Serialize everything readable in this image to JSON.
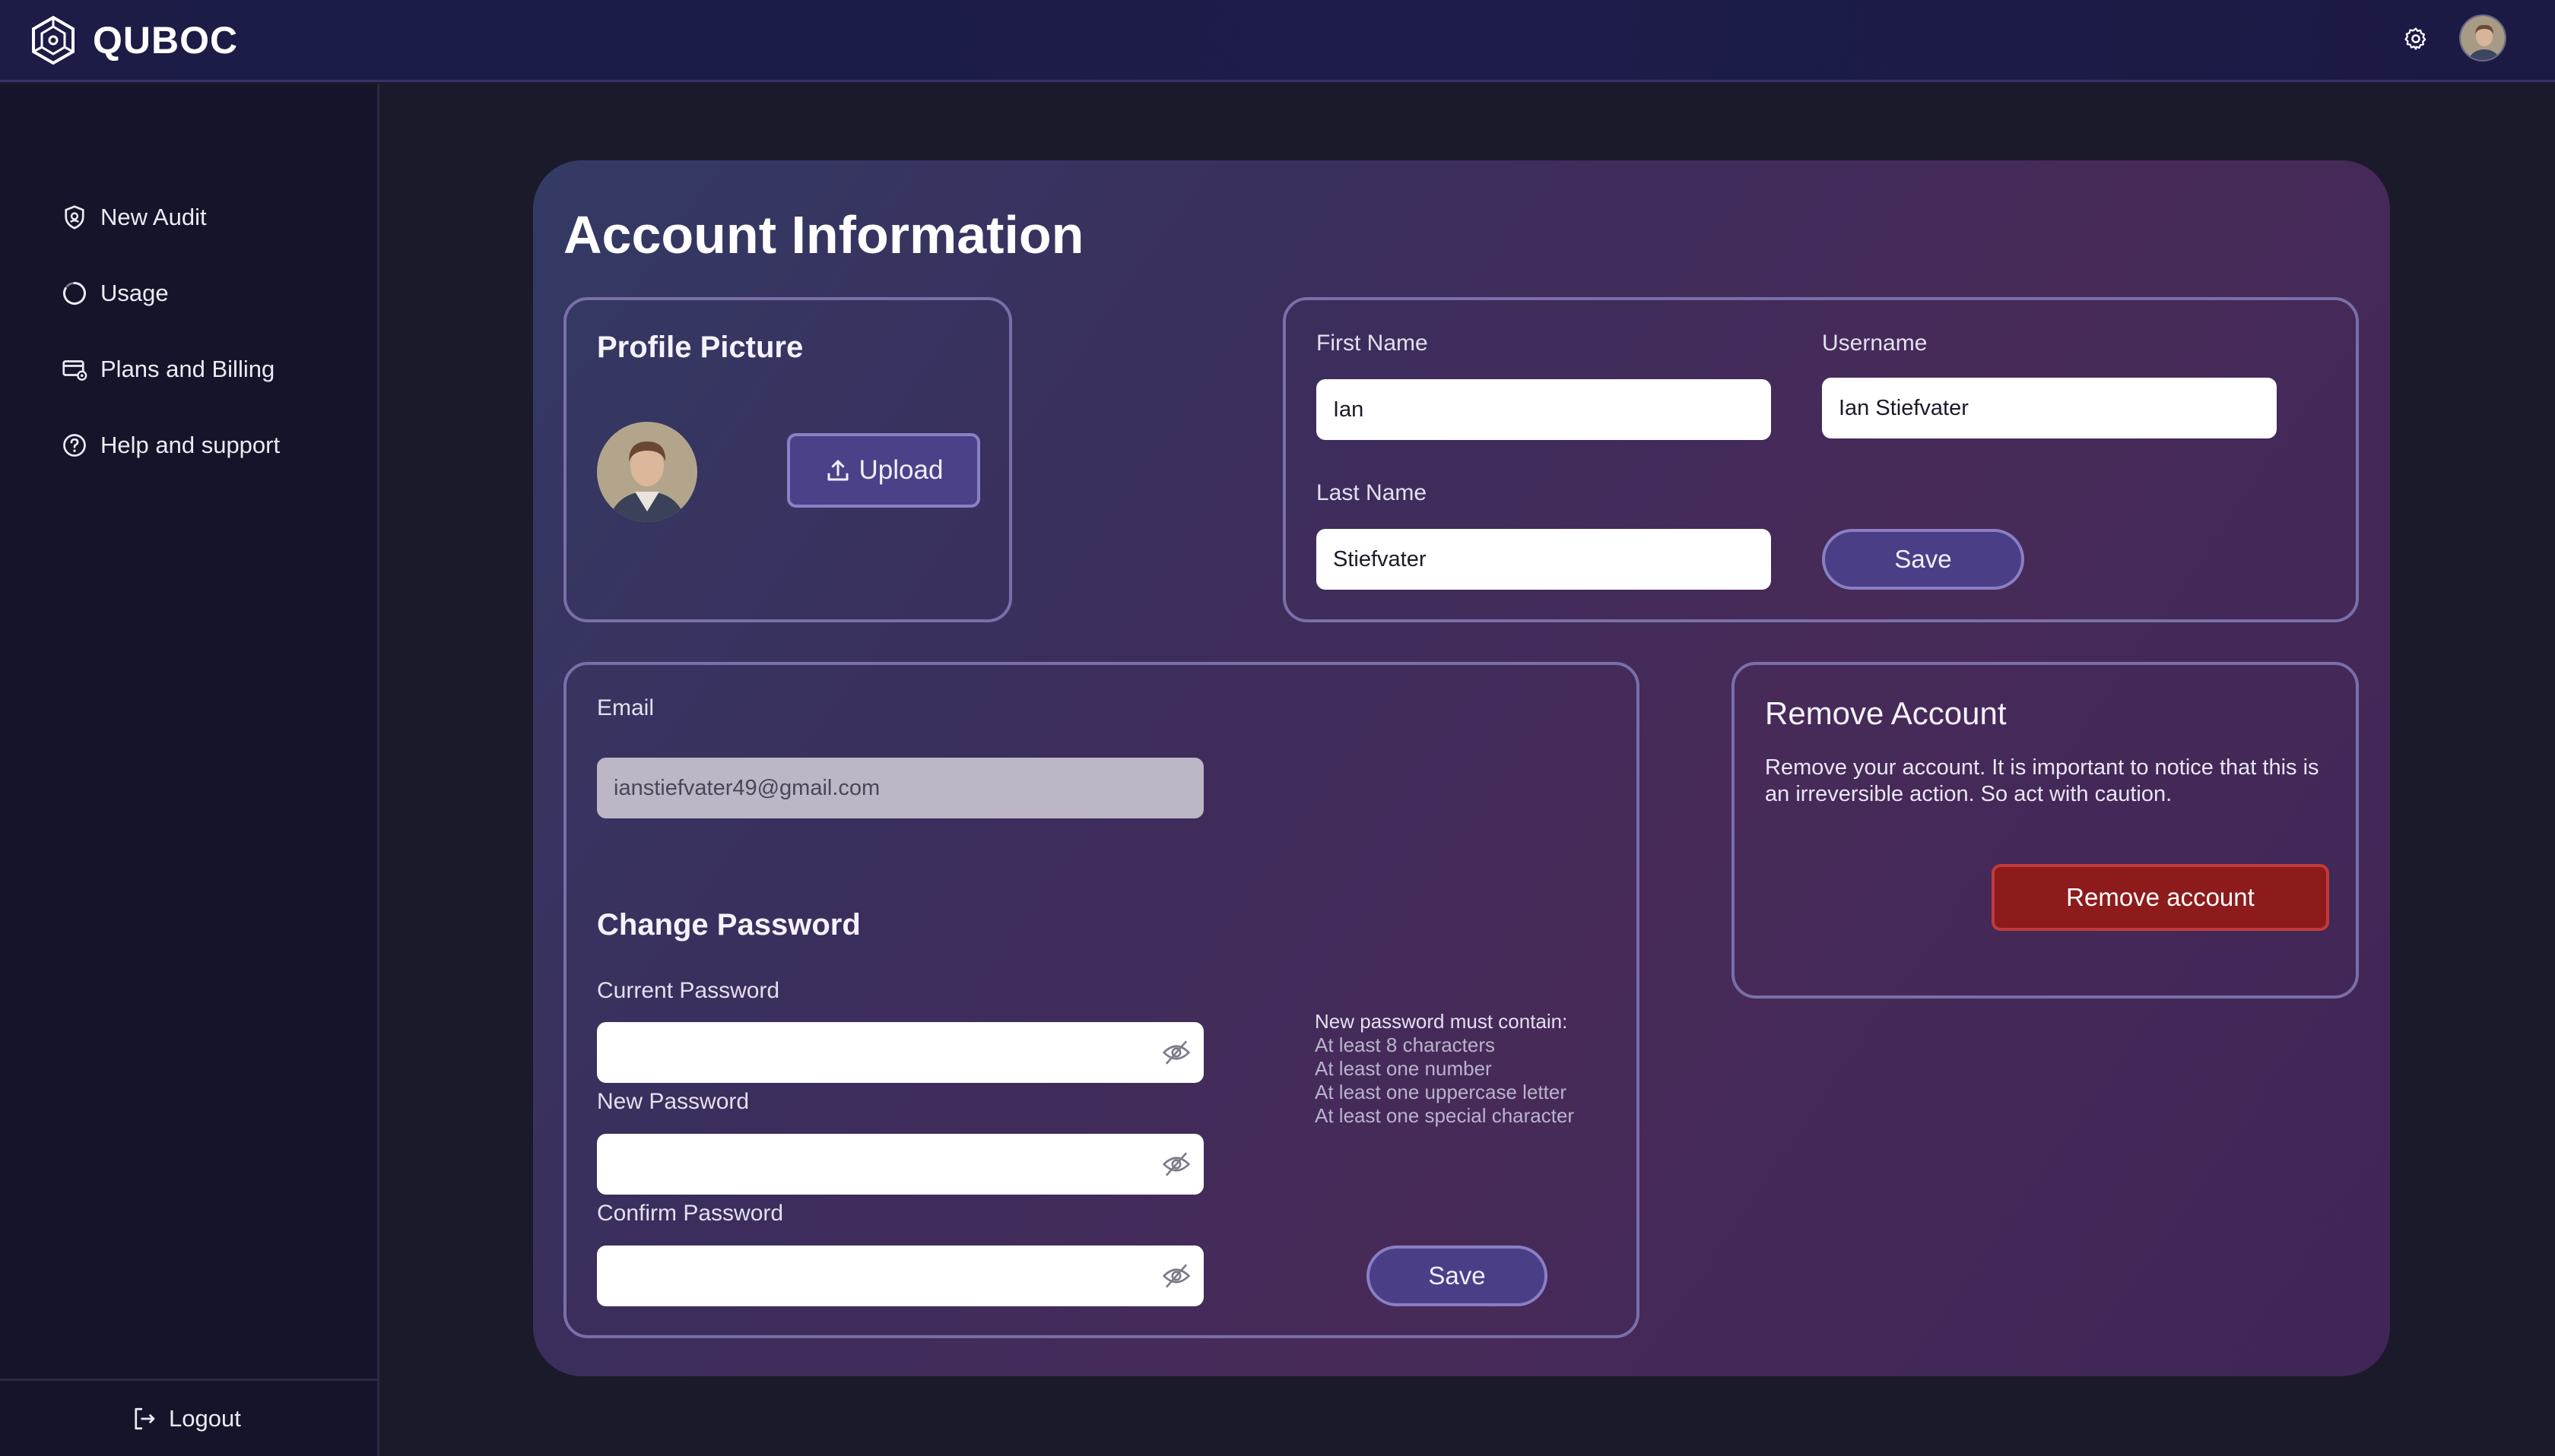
{
  "app": {
    "name": "QUBOC"
  },
  "sidebar": {
    "items": [
      {
        "label": "New Audit",
        "icon": "shield-icon"
      },
      {
        "label": "Usage",
        "icon": "circle-progress-icon"
      },
      {
        "label": "Plans and Billing",
        "icon": "billing-card-icon"
      },
      {
        "label": "Help and support",
        "icon": "help-circle-icon"
      }
    ],
    "logout_label": "Logout"
  },
  "page": {
    "title": "Account Information"
  },
  "profile_picture": {
    "title": "Profile Picture",
    "upload_label": "Upload"
  },
  "name_form": {
    "first_name_label": "First Name",
    "first_name_value": "Ian",
    "username_label": "Username",
    "username_value": "Ian Stiefvater",
    "last_name_label": "Last Name",
    "last_name_value": "Stiefvater",
    "save_label": "Save"
  },
  "email": {
    "label": "Email",
    "value": "ianstiefvater49@gmail.com"
  },
  "change_password": {
    "title": "Change Password",
    "current_label": "Current Password",
    "new_label": "New Password",
    "confirm_label": "Confirm Password",
    "rules_heading": "New password must contain:",
    "rules": [
      "At least 8 characters",
      "At least one number",
      "At least one uppercase letter",
      "At least one special character"
    ],
    "save_label": "Save"
  },
  "remove_account": {
    "title": "Remove Account",
    "description": "Remove your account. It is important to notice that this is an irreversible action. So act with caution.",
    "button_label": "Remove account"
  },
  "colors": {
    "topbar": "#1c1c47",
    "sidebar": "#15142a",
    "accent_purple": "#4a3f87",
    "danger": "#8e1b1b"
  }
}
